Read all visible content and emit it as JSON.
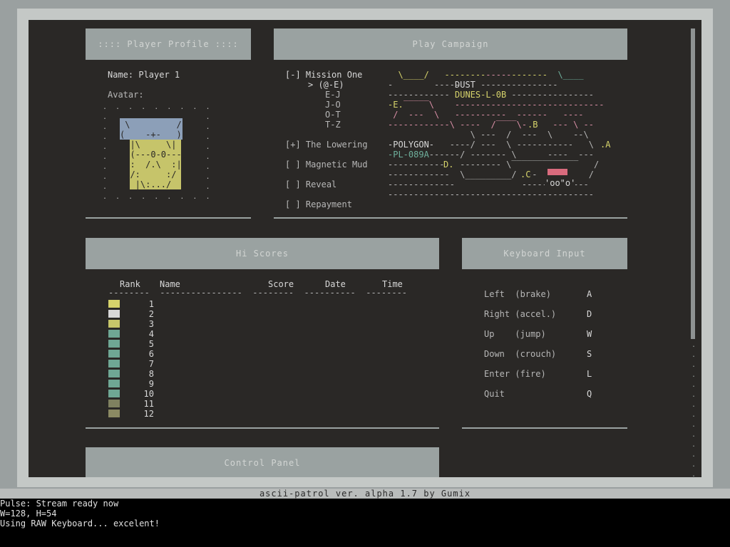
{
  "profile": {
    "title": "::::  Player  Profile  ::::",
    "name_label": "Name:",
    "name_value": "Player 1",
    "avatar_label": "Avatar:"
  },
  "campaign": {
    "title": "Play  Campaign",
    "missions": [
      {
        "marker": "[-]",
        "label": "Mission One"
      },
      {
        "marker": "[+]",
        "label": "The Lowering"
      },
      {
        "marker": "[ ]",
        "label": "Magnetic Mud"
      },
      {
        "marker": "[ ]",
        "label": "Reveal"
      },
      {
        "marker": "[ ]",
        "label": "Repayment"
      }
    ],
    "sub_items": [
      "> (@-E)",
      "E-J",
      "J-O",
      "O-T",
      "T-Z"
    ],
    "map_labels": {
      "dust": "DUST",
      "dunes": "DUNES-L-0B",
      "polygon": "-POLYGON-",
      "pl": "-PL-089A",
      "e": "-E.",
      "b": ".B",
      "a": ".A",
      "d": "D.",
      "c": ".C"
    }
  },
  "hiscores": {
    "title": "Hi  Scores",
    "headers": [
      "Rank",
      "Name",
      "Score",
      "Date",
      "Time"
    ],
    "ranks": [
      "1",
      "2",
      "3",
      "4",
      "5",
      "6",
      "7",
      "8",
      "9",
      "10",
      "11",
      "12"
    ],
    "swatch_colors": [
      "#d6d36b",
      "#d8d8d8",
      "#c7c66a",
      "#6fa794",
      "#6fa794",
      "#6fa794",
      "#6fa794",
      "#6fa794",
      "#6fa794",
      "#6fa794",
      "#7f8160",
      "#8b8a63"
    ]
  },
  "keyboard": {
    "title": "Keyboard  Input",
    "bindings": [
      {
        "action": "Left  (brake)",
        "key": "A"
      },
      {
        "action": "Right (accel.)",
        "key": "D"
      },
      {
        "action": "Up    (jump)",
        "key": "W"
      },
      {
        "action": "Down  (crouch)",
        "key": "S"
      },
      {
        "action": "Enter (fire)",
        "key": "L"
      },
      {
        "action": "Quit",
        "key": "Q"
      }
    ]
  },
  "control_panel": {
    "title": "Control  Panel"
  },
  "footer": "ascii-patrol ver. alpha 1.7 by Gumix",
  "terminal": [
    "Pulse: Stream ready now",
    "W=128, H=54",
    "Using RAW Keyboard... excelent!"
  ],
  "colors": {
    "accent_yellow": "#d6d36b",
    "accent_cyan": "#6fb09c",
    "accent_pink": "#d98fa6",
    "bar_gray": "#9aa2a1"
  }
}
